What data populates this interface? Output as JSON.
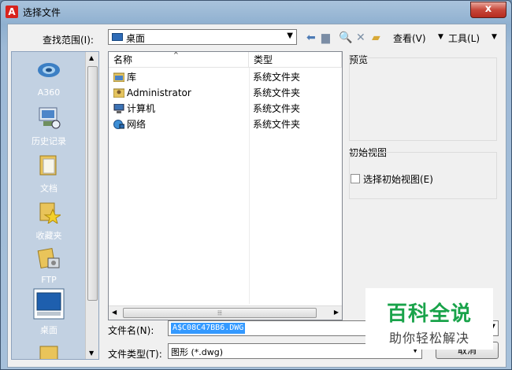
{
  "window": {
    "title": "选择文件",
    "close_glyph": "x"
  },
  "toolbar": {
    "lookin_label": "查找范围(I):",
    "lookin_value": "桌面",
    "view_label": "查看(V)",
    "tools_label": "工具(L)"
  },
  "places": [
    {
      "label": "A360",
      "icon": "a360-icon"
    },
    {
      "label": "历史记录",
      "icon": "history-icon"
    },
    {
      "label": "文档",
      "icon": "documents-icon"
    },
    {
      "label": "收藏夹",
      "icon": "favorites-icon"
    },
    {
      "label": "FTP",
      "icon": "ftp-icon"
    },
    {
      "label": "桌面",
      "icon": "desktop-icon"
    }
  ],
  "filelist": {
    "headers": {
      "name": "名称",
      "type": "类型"
    },
    "rows": [
      {
        "name": "库",
        "type": "系统文件夹",
        "icon": "library-icon"
      },
      {
        "name": "Administrator",
        "type": "系统文件夹",
        "icon": "user-folder-icon"
      },
      {
        "name": "计算机",
        "type": "系统文件夹",
        "icon": "computer-icon"
      },
      {
        "name": "网络",
        "type": "系统文件夹",
        "icon": "network-icon"
      }
    ]
  },
  "preview": {
    "title": "预览"
  },
  "initial_view": {
    "title": "初始视图",
    "checkbox_label": "选择初始视图(E)",
    "checked": false
  },
  "filename": {
    "label": "文件名(N):",
    "value": "A$C08C47BB6.DWG"
  },
  "filetype": {
    "label": "文件类型(T):",
    "value": "图形 (*.dwg)"
  },
  "buttons": {
    "cancel": "取消"
  },
  "watermark": {
    "title": "百科全说",
    "subtitle": "助你轻松解决"
  }
}
